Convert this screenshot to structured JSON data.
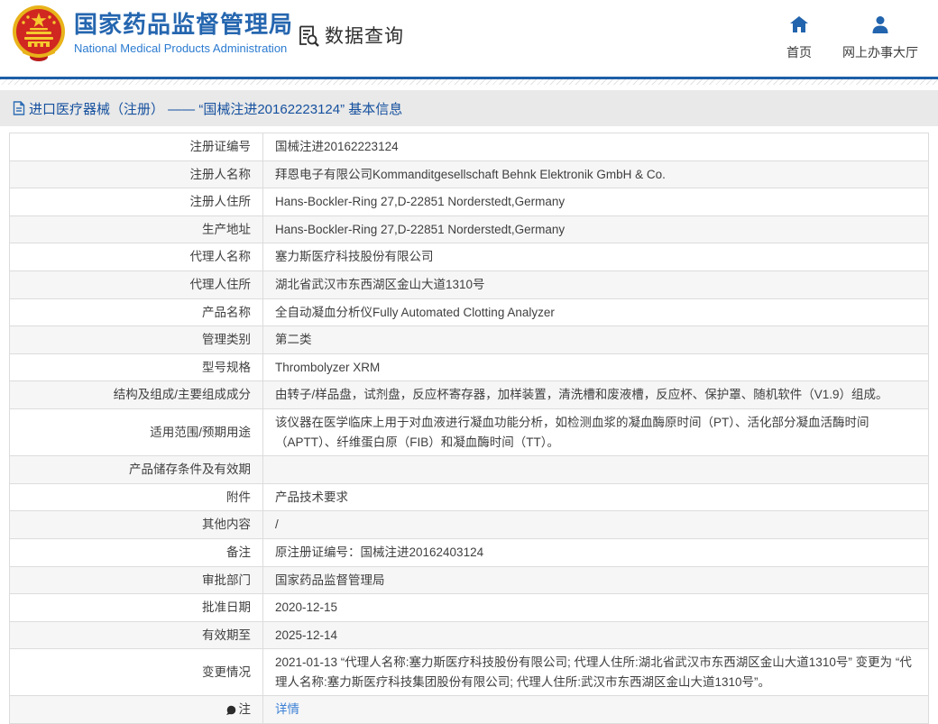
{
  "header": {
    "site_title_zh": "国家药品监督管理局",
    "site_title_en": "National Medical Products Administration",
    "dataquery_label": "数据查询",
    "nav": [
      {
        "label": "首页",
        "icon": "home-icon"
      },
      {
        "label": "网上办事大厅",
        "icon": "user-icon"
      }
    ]
  },
  "breadcrumb": {
    "text": "进口医疗器械（注册） —— “国械注进20162223124” 基本信息"
  },
  "table": {
    "rows": [
      {
        "label": "注册证编号",
        "value": "国械注进20162223124"
      },
      {
        "label": "注册人名称",
        "value": "拜恩电子有限公司Kommanditgesellschaft Behnk Elektronik GmbH & Co."
      },
      {
        "label": "注册人住所",
        "value": "Hans-Bockler-Ring 27,D-22851 Norderstedt,Germany"
      },
      {
        "label": "生产地址",
        "value": "Hans-Bockler-Ring 27,D-22851 Norderstedt,Germany"
      },
      {
        "label": "代理人名称",
        "value": "塞力斯医疗科技股份有限公司"
      },
      {
        "label": "代理人住所",
        "value": "湖北省武汉市东西湖区金山大道1310号"
      },
      {
        "label": "产品名称",
        "value": "全自动凝血分析仪Fully Automated Clotting Analyzer"
      },
      {
        "label": "管理类别",
        "value": "第二类"
      },
      {
        "label": "型号规格",
        "value": "Thrombolyzer XRM"
      },
      {
        "label": "结构及组成/主要组成成分",
        "value": "由转子/样品盘，试剂盘，反应杯寄存器，加样装置，清洗槽和废液槽，反应杯、保护罩、随机软件（V1.9）组成。"
      },
      {
        "label": "适用范围/预期用途",
        "value": "该仪器在医学临床上用于对血液进行凝血功能分析，如检测血浆的凝血酶原时间（PT）、活化部分凝血活酶时间（APTT）、纤维蛋白原（FIB）和凝血酶时间（TT）。"
      },
      {
        "label": "产品储存条件及有效期",
        "value": ""
      },
      {
        "label": "附件",
        "value": "产品技术要求"
      },
      {
        "label": "其他内容",
        "value": "/"
      },
      {
        "label": "备注",
        "value": "原注册证编号：国械注进20162403124"
      },
      {
        "label": "审批部门",
        "value": "国家药品监督管理局"
      },
      {
        "label": "批准日期",
        "value": "2020-12-15"
      },
      {
        "label": "有效期至",
        "value": "2025-12-14"
      },
      {
        "label": "变更情况",
        "value": "2021-01-13 “代理人名称:塞力斯医疗科技股份有限公司; 代理人住所:湖北省武汉市东西湖区金山大道1310号” 变更为 “代理人名称:塞力斯医疗科技集团股份有限公司; 代理人住所:武汉市东西湖区金山大道1310号”。"
      },
      {
        "label": "注",
        "value": "详情",
        "link": true,
        "label_icon": "note"
      }
    ]
  },
  "colors": {
    "accent_blue": "#1e5fa6",
    "title_blue": "#2566af",
    "subtitle_blue": "#2b7bd0",
    "nav_icon_blue": "#2264ad",
    "link_blue": "#3a7fd5",
    "breadcrumb_bg": "#e9e9e9",
    "row_alt_bg": "#f6f6f6",
    "table_border": "#dcdcdc",
    "text": "#3f3f3f",
    "emblem_red": "#d02721",
    "emblem_gold": "#e8b31a"
  }
}
